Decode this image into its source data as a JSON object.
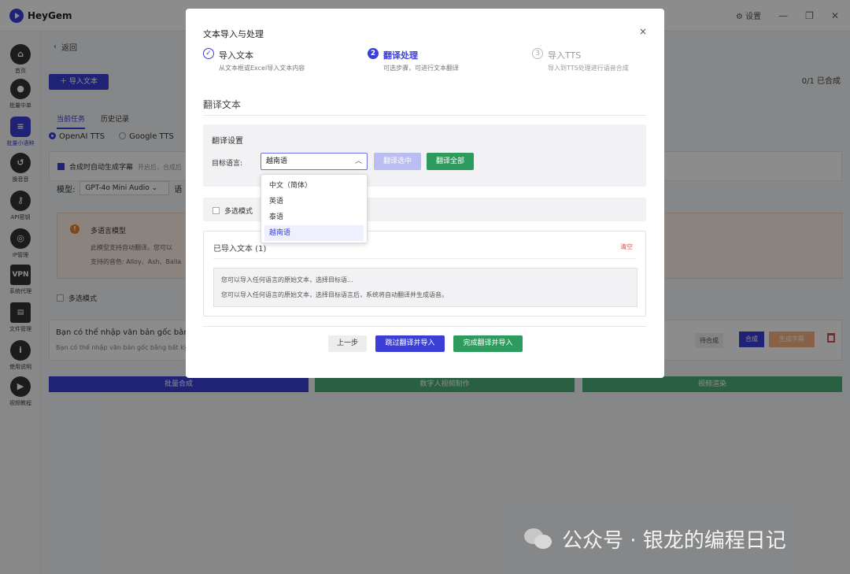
{
  "app": {
    "name": "HeyGem",
    "settings_label": "设置",
    "win_controls": [
      "—",
      "❐",
      "✕"
    ]
  },
  "sidebar": {
    "items": [
      {
        "label": "首页",
        "icon": "home-icon",
        "glyph": "⌂"
      },
      {
        "label": "批量中单",
        "icon": "batch-icon",
        "glyph": "●"
      },
      {
        "label": "批量小语种",
        "icon": "language-icon",
        "glyph": "≡"
      },
      {
        "label": "换音音",
        "icon": "swap-audio-icon",
        "glyph": "↺"
      },
      {
        "label": "API密钥",
        "icon": "key-icon",
        "glyph": "⚷"
      },
      {
        "label": "IP管理",
        "icon": "globe-icon",
        "glyph": "◎"
      },
      {
        "label": "系统代理",
        "icon": "vpn-icon",
        "glyph": "VPN"
      },
      {
        "label": "文件管理",
        "icon": "file-icon",
        "glyph": "▤"
      },
      {
        "label": "使用说明",
        "icon": "info-icon",
        "glyph": "i"
      },
      {
        "label": "视频教程",
        "icon": "video-icon",
        "glyph": "▶"
      }
    ]
  },
  "background": {
    "back_label": "返回",
    "import_button": "＋ 导入文本",
    "count_label": "0/1 已合成",
    "tabs": [
      "当前任务",
      "历史记录"
    ],
    "tts_options": [
      "OpenAI TTS",
      "Google TTS"
    ],
    "auto_subtitle_label": "合成时自动生成字幕",
    "auto_subtitle_hint": "开启后，合成后",
    "model_label": "模型:",
    "model_value": "GPT-4o Mini Audio",
    "model_suffix": "语",
    "warn_title": "多语言模型",
    "warn_line1": "此模型支持自动翻译。您可以",
    "warn_line2": "支持的音色: Alloy、Ash、Balla",
    "multi_select_label": "多选模式",
    "row_text": "Bạn có thể nhập văn bản gốc bằng b",
    "row_subtext": "Bạn có thể nhập văn bản gốc bằng bất kỳ n",
    "row_status": "待合成",
    "row_compose": "合成",
    "row_subtitle": "生成字幕",
    "bottom_buttons": [
      "批量合成",
      "数字人视频制作",
      "视频渲染"
    ]
  },
  "modal": {
    "title": "文本导入与处理",
    "close": "×",
    "steps": [
      {
        "num": "✓",
        "name": "导入文本",
        "desc": "从文本框或Excel导入文本内容"
      },
      {
        "num": "2",
        "name": "翻译处理",
        "desc": "可选步骤，可进行文本翻译"
      },
      {
        "num": "3",
        "name": "导入TTS",
        "desc": "导入到TTS处理进行语音合成"
      }
    ],
    "section_title": "翻译文本",
    "settings_label": "翻译设置",
    "target_label": "目标语言:",
    "target_value": "越南语",
    "caret": "︿",
    "translate_selected": "翻译选中",
    "translate_all": "翻译全部",
    "multi_select_label": "多选模式",
    "imported_title": "已导入文本 (1)",
    "clear_label": "清空",
    "imported_line1": "您可以导入任何语言的原始文本，选择目标语...",
    "imported_line2": "您可以导入任何语言的原始文本，选择目标语言后，系统将自动翻译并生成语音。",
    "prev_button": "上一步",
    "skip_button": "跳过翻译并导入",
    "finish_button": "完成翻译并导入"
  },
  "dropdown": {
    "options": [
      "中文（简体）",
      "英语",
      "泰语",
      "越南语"
    ],
    "selected": "越南语"
  },
  "watermark": {
    "text": "公众号 · 银龙的编程日记"
  },
  "colors": {
    "accent": "#3b3fd8",
    "success": "#2e9b5e",
    "danger": "#d9534f",
    "warning": "#e8832f"
  }
}
